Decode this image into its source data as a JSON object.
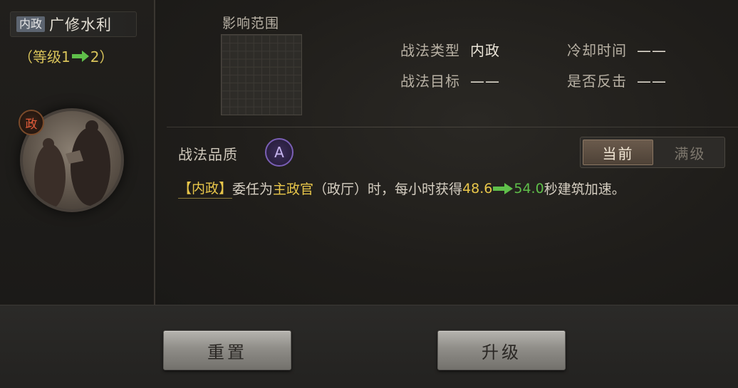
{
  "skill": {
    "type_tag": "内政",
    "name": "广修水利",
    "level_prefix": "（等级1",
    "level_to": "2）",
    "portrait_badge": "政"
  },
  "range": {
    "label": "影响范围"
  },
  "info": {
    "type_key": "战法类型",
    "type_value": "内政",
    "cooldown_key": "冷却时间",
    "cooldown_value": "——",
    "target_key": "战法目标",
    "target_value": "——",
    "counter_key": "是否反击",
    "counter_value": "——"
  },
  "quality": {
    "label": "战法品质",
    "grade": "A"
  },
  "toggle": {
    "current": "当前",
    "max": "满级",
    "selected": "current"
  },
  "description": {
    "tag": "【内政】",
    "part1": "委任为",
    "role": "主政官",
    "part2": "（政厅）时，每小时获得",
    "from_value": "48.6",
    "to_value": "54.0",
    "part3": "秒建筑加速。"
  },
  "buttons": {
    "reset": "重置",
    "upgrade": "升级"
  },
  "colors": {
    "accent_yellow": "#e8c64a",
    "accent_green": "#5fbf4a",
    "quality_purple": "#7a5fb5"
  }
}
